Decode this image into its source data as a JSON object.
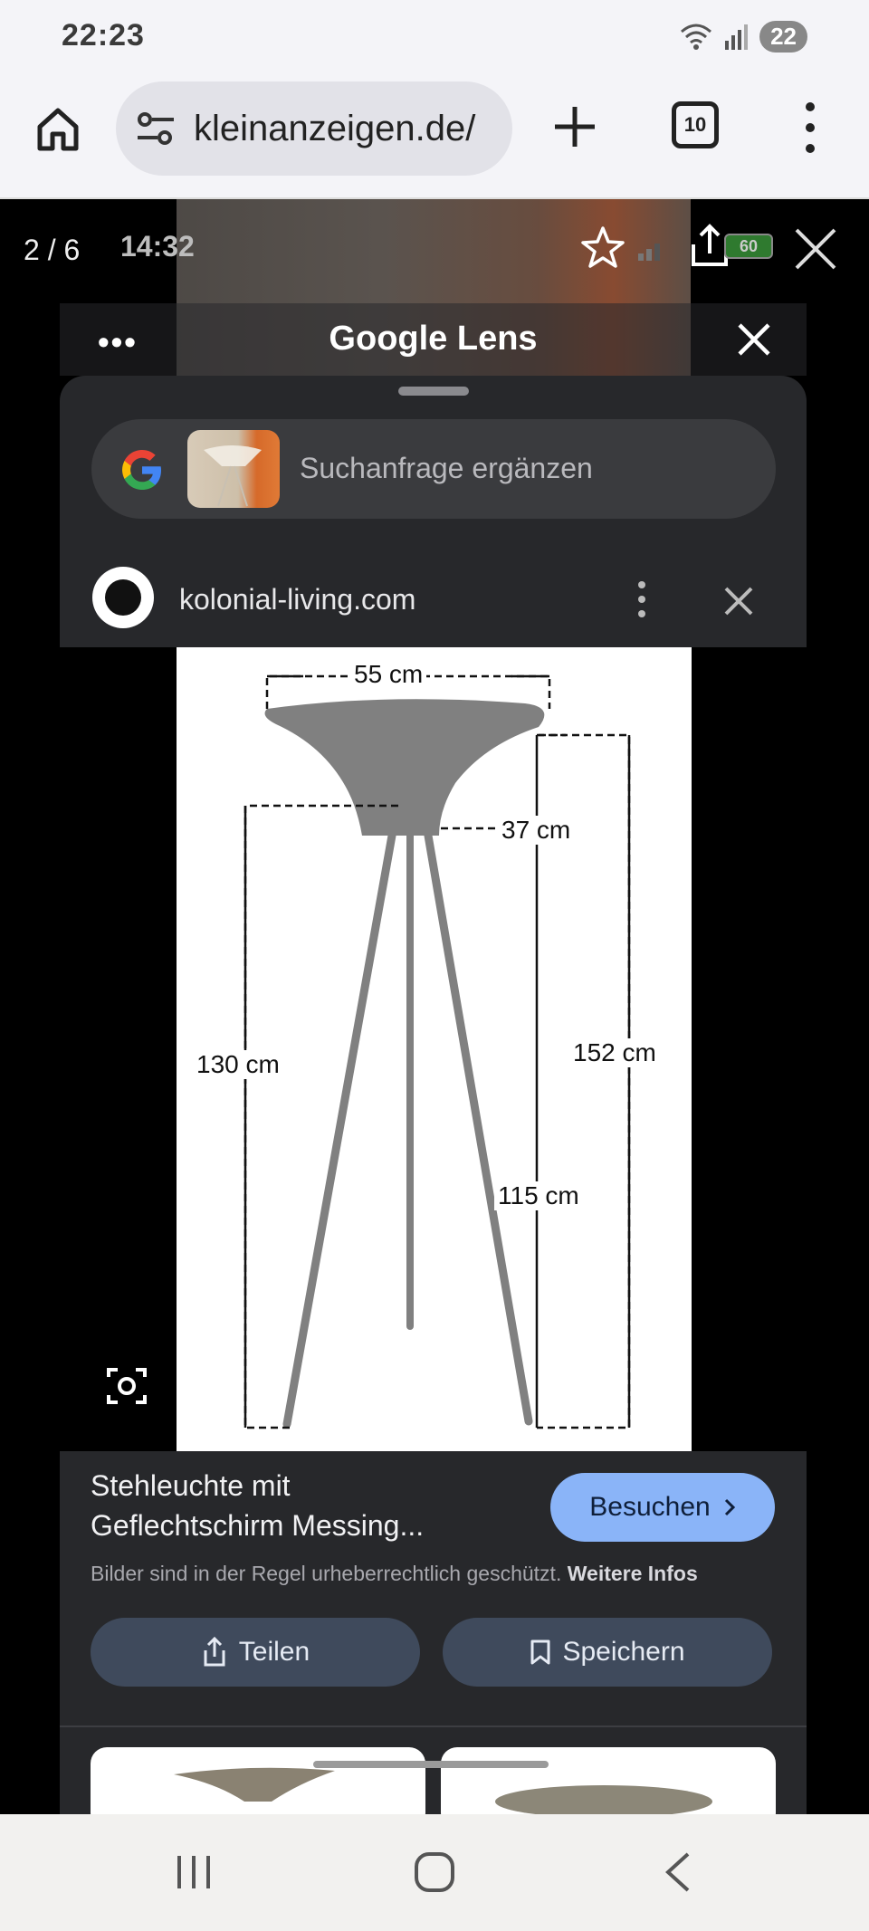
{
  "status_bar": {
    "time": "22:23",
    "notification_count": "22",
    "icons": [
      "wifi-icon",
      "signal-icon"
    ]
  },
  "browser": {
    "url": "kleinanzeigen.de/",
    "tab_count": "10",
    "icons": [
      "home-icon",
      "site-settings-icon",
      "new-tab-icon",
      "tabs-icon",
      "menu-icon"
    ]
  },
  "viewer": {
    "counter": "2 / 6",
    "embedded_time": "14:32",
    "embedded_battery": "60",
    "icons": [
      "star-icon",
      "share-icon",
      "close-icon"
    ]
  },
  "lens": {
    "header_title": "Google Lens",
    "more_label": "•••",
    "search_placeholder": "Suchanfrage ergänzen",
    "source_name": "kolonial-living.com"
  },
  "diagram": {
    "width_label": "55 cm",
    "shade_height_label": "37 cm",
    "left_height_label": "130 cm",
    "total_height_label": "152 cm",
    "leg_height_label": "115 cm"
  },
  "result": {
    "title_line1": "Stehleuchte mit",
    "title_line2": "Geflechtschirm Messing...",
    "visit_label": "Besuchen",
    "copyright_text": "Bilder sind in der Regel urheberrechtlich geschützt.",
    "copyright_link": "Weitere Infos",
    "share_label": "Teilen",
    "save_label": "Speichern"
  },
  "colors": {
    "accent_blue": "#8ab4f8",
    "sheet_bg": "#27282b",
    "button_bg": "#3f4a5c"
  }
}
